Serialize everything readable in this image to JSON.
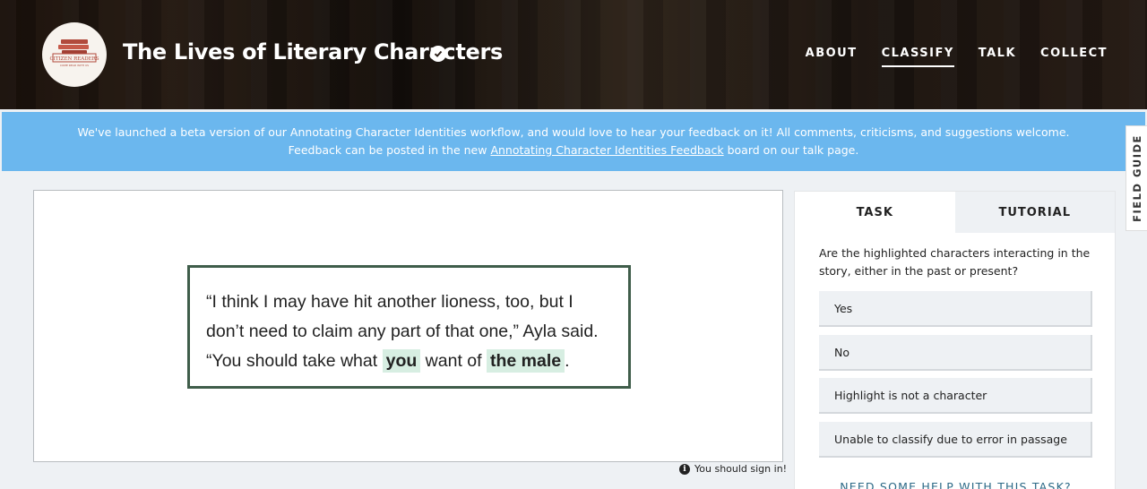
{
  "header": {
    "logo_text": "CITIZEN READERS",
    "logo_tagline": "COME READ WITH US",
    "project_title": "The Lives of Literary Characters",
    "nav": [
      {
        "label": "ABOUT"
      },
      {
        "label": "CLASSIFY",
        "active": true
      },
      {
        "label": "TALK"
      },
      {
        "label": "COLLECT"
      }
    ]
  },
  "banner": {
    "line1": "We've launched a beta version of our Annotating Character Identities workflow, and would love to hear your feedback on it! All comments, criticisms, and suggestions welcome.",
    "line2_before": "Feedback can be posted in the new ",
    "line2_link": "Annotating Character Identities Feedback",
    "line2_after": " board on our talk page."
  },
  "field_guide": {
    "label": "FIELD GUIDE"
  },
  "subject": {
    "text_1": "“I think I may have hit another lioness, too, but I don’t need to claim any part of that one,” Ayla said. “You should take what ",
    "highlight_1": "you",
    "text_2": " want of ",
    "highlight_2": "the male",
    "text_3": "."
  },
  "signin": {
    "message": "You should sign in!",
    "icon": "info-icon"
  },
  "task_panel": {
    "tabs": [
      {
        "label": "TASK"
      },
      {
        "label": "TUTORIAL"
      }
    ],
    "question": "Are the highlighted characters interacting in the story, either in the past or present?",
    "answers": [
      {
        "label": "Yes"
      },
      {
        "label": "No"
      },
      {
        "label": "Highlight is not a character"
      },
      {
        "label": "Unable to classify due to error in passage"
      }
    ],
    "help_link": "NEED SOME HELP WITH THIS TASK?"
  },
  "colors": {
    "banner": "#6bb7ee",
    "passage_border": "#3f5d4a",
    "highlight": "#d7eee2",
    "help_link": "#2d6a87"
  }
}
